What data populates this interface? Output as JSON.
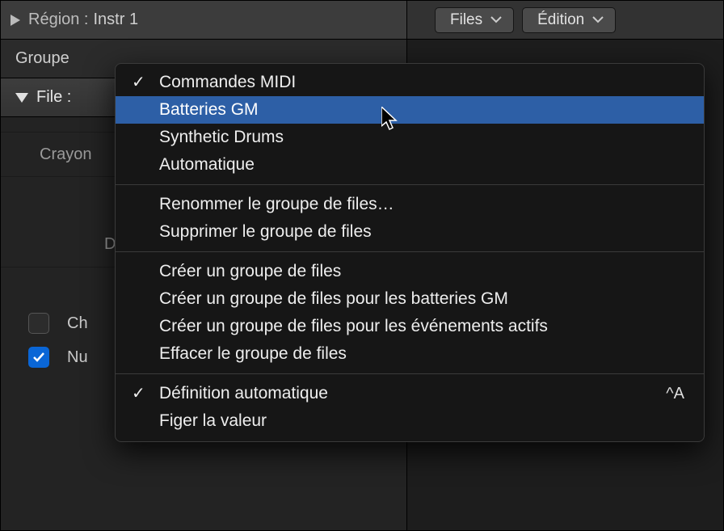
{
  "region": {
    "label": "Région :",
    "value": "Instr 1"
  },
  "group_section": {
    "label": "Groupe"
  },
  "file_section": {
    "label": "File :"
  },
  "left_rows": {
    "crayon": "Crayon",
    "row_d": "D",
    "check1_label": "Ch",
    "check2_label": "Nu"
  },
  "toolbar": {
    "files_label": "Files",
    "edition_label": "Édition"
  },
  "menu": {
    "section1": [
      {
        "label": "Commandes MIDI",
        "checked": true
      },
      {
        "label": "Batteries GM",
        "highlight": true
      },
      {
        "label": "Synthetic Drums"
      },
      {
        "label": "Automatique"
      }
    ],
    "section2": [
      {
        "label": "Renommer le groupe de files…"
      },
      {
        "label": "Supprimer le groupe de files"
      }
    ],
    "section3": [
      {
        "label": "Créer un groupe de files"
      },
      {
        "label": "Créer un groupe de files pour les batteries GM"
      },
      {
        "label": "Créer un groupe de files pour les événements actifs"
      },
      {
        "label": "Effacer le groupe de files"
      }
    ],
    "section4": [
      {
        "label": "Définition automatique",
        "checked": true,
        "shortcut": "^A"
      },
      {
        "label": "Figer la valeur"
      }
    ]
  }
}
